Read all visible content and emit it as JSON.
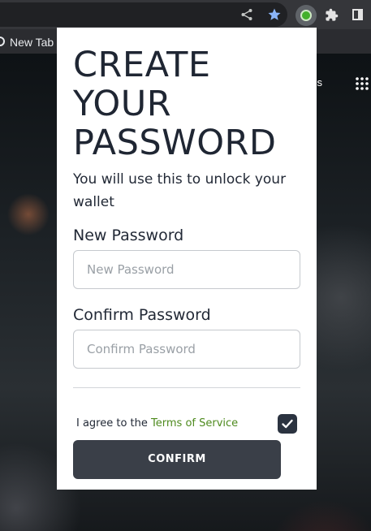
{
  "browser": {
    "tab_label": "New Tab",
    "images_link": "ges",
    "toolbar_icons": [
      "share-icon",
      "bookmark-star-icon",
      "wallet-extension-icon",
      "extensions-puzzle-icon",
      "side-panel-icon"
    ],
    "apps_icon": "apps-grid-icon"
  },
  "popup": {
    "title": "CREATE YOUR PASSWORD",
    "subtitle": "You will use this to unlock your wallet",
    "new_password": {
      "label": "New Password",
      "placeholder": "New Password",
      "value": ""
    },
    "confirm_password": {
      "label": "Confirm Password",
      "placeholder": "Confirm Password",
      "value": ""
    },
    "agree_prefix": "I agree to the ",
    "terms_link": "Terms of Service",
    "agree_checked": true,
    "confirm_button": "CONFIRM"
  },
  "colors": {
    "primary_button": "#3a3f48",
    "link": "#4e8a1e",
    "checkbox": "#2b3340",
    "bookmark_star": "#8ab4f8"
  }
}
